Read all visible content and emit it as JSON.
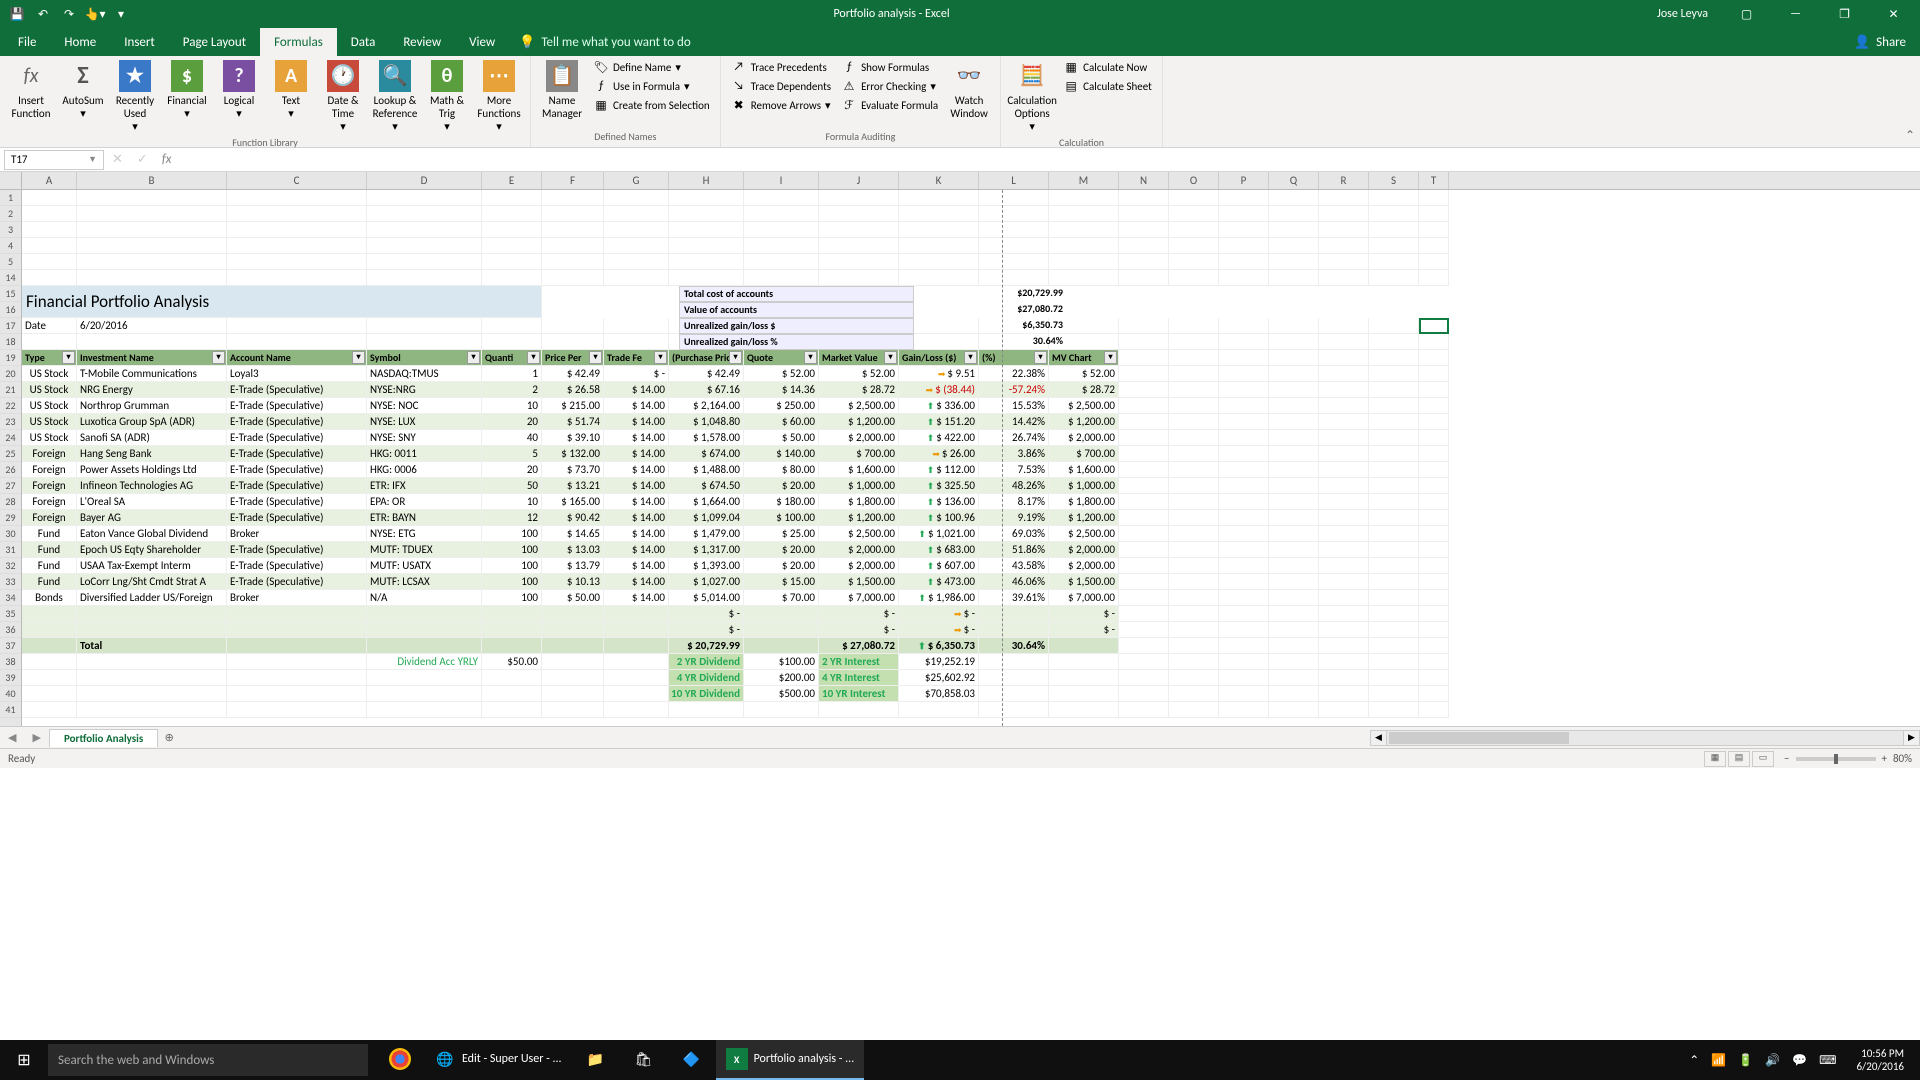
{
  "titlebar": {
    "title": "Portfolio analysis - Excel",
    "user": "Jose Leyva"
  },
  "tabs": [
    "File",
    "Home",
    "Insert",
    "Page Layout",
    "Formulas",
    "Data",
    "Review",
    "View"
  ],
  "active_tab": "Formulas",
  "tell_me": "Tell me what you want to do",
  "share": "Share",
  "ribbon": {
    "groups": {
      "fl": "Function Library",
      "dn": "Defined Names",
      "fa": "Formula Auditing",
      "ca": "Calculation"
    },
    "buttons": {
      "insert_fn": "Insert Function",
      "autosum": "AutoSum",
      "recent": "Recently Used",
      "financial": "Financial",
      "logical": "Logical",
      "text": "Text",
      "datetime": "Date & Time",
      "lookup": "Lookup & Reference",
      "math": "Math & Trig",
      "more": "More Functions",
      "name_mgr": "Name Manager",
      "def_name": "Define Name",
      "use_formula": "Use in Formula",
      "create_sel": "Create from Selection",
      "trace_prec": "Trace Precedents",
      "trace_dep": "Trace Dependents",
      "remove_arr": "Remove Arrows",
      "show_form": "Show Formulas",
      "err_check": "Error Checking",
      "eval_form": "Evaluate Formula",
      "watch": "Watch Window",
      "calc_opt": "Calculation Options",
      "calc_now": "Calculate Now",
      "calc_sheet": "Calculate Sheet"
    }
  },
  "namebox": "T17",
  "columns": [
    "A",
    "B",
    "C",
    "D",
    "E",
    "F",
    "G",
    "H",
    "I",
    "J",
    "K",
    "L",
    "M",
    "N",
    "O",
    "P",
    "Q",
    "R",
    "S",
    "T"
  ],
  "row_nums_top": [
    "1",
    "2",
    "3",
    "4",
    "5",
    "14"
  ],
  "portfolio": {
    "title": "Financial Portfolio Analysis",
    "date_label": "Date",
    "date": "6/20/2016",
    "summary": [
      {
        "label": "Total cost of accounts",
        "value": "$20,729.99"
      },
      {
        "label": "Value of accounts",
        "value": "$27,080.72"
      },
      {
        "label": "Unrealized gain/loss $",
        "value": "$6,350.73"
      },
      {
        "label": "Unrealized gain/loss %",
        "value": "30.64%"
      }
    ],
    "headers": [
      "Type",
      "Investment Name",
      "Account Name",
      "Symbol",
      "Quanti",
      "Price Per",
      "Trade Fe",
      "(Purchase Pric",
      "Quote",
      "Market Value",
      "Gain/Loss ($)",
      "(%)",
      "MV Chart"
    ],
    "rows": [
      {
        "n": "20",
        "type": "US Stock",
        "inv": "T-Mobile Communications",
        "acct": "Loyal3",
        "sym": "NASDAQ:TMUS",
        "qty": "1",
        "pp": "42.49",
        "tf": "-",
        "pur": "42.49",
        "q": "52.00",
        "mv": "52.00",
        "gl": "9.51",
        "pct": "22.38%",
        "mvc": "52.00",
        "arr": "dn"
      },
      {
        "n": "21",
        "type": "US Stock",
        "inv": "NRG Energy",
        "acct": "E-Trade (Speculative)",
        "sym": "NYSE:NRG",
        "qty": "2",
        "pp": "26.58",
        "tf": "14.00",
        "pur": "67.16",
        "q": "14.36",
        "mv": "28.72",
        "gl": "(38.44)",
        "pct": "-57.24%",
        "mvc": "28.72",
        "arr": "dn",
        "neg": true
      },
      {
        "n": "22",
        "type": "US Stock",
        "inv": "Northrop Grumman",
        "acct": "E-Trade (Speculative)",
        "sym": "NYSE: NOC",
        "qty": "10",
        "pp": "215.00",
        "tf": "14.00",
        "pur": "2,164.00",
        "q": "250.00",
        "mv": "2,500.00",
        "gl": "336.00",
        "pct": "15.53%",
        "mvc": "2,500.00",
        "arr": "up"
      },
      {
        "n": "23",
        "type": "US Stock",
        "inv": "Luxotica Group SpA (ADR)",
        "acct": "E-Trade (Speculative)",
        "sym": "NYSE: LUX",
        "qty": "20",
        "pp": "51.74",
        "tf": "14.00",
        "pur": "1,048.80",
        "q": "60.00",
        "mv": "1,200.00",
        "gl": "151.20",
        "pct": "14.42%",
        "mvc": "1,200.00",
        "arr": "up"
      },
      {
        "n": "24",
        "type": "US Stock",
        "inv": "Sanofi SA (ADR)",
        "acct": "E-Trade (Speculative)",
        "sym": "NYSE: SNY",
        "qty": "40",
        "pp": "39.10",
        "tf": "14.00",
        "pur": "1,578.00",
        "q": "50.00",
        "mv": "2,000.00",
        "gl": "422.00",
        "pct": "26.74%",
        "mvc": "2,000.00",
        "arr": "up"
      },
      {
        "n": "25",
        "type": "Foreign",
        "inv": "Hang Seng Bank",
        "acct": "E-Trade (Speculative)",
        "sym": "HKG: 0011",
        "qty": "5",
        "pp": "132.00",
        "tf": "14.00",
        "pur": "674.00",
        "q": "140.00",
        "mv": "700.00",
        "gl": "26.00",
        "pct": "3.86%",
        "mvc": "700.00",
        "arr": "dn"
      },
      {
        "n": "26",
        "type": "Foreign",
        "inv": "Power Assets Holdings Ltd",
        "acct": "E-Trade (Speculative)",
        "sym": "HKG: 0006",
        "qty": "20",
        "pp": "73.70",
        "tf": "14.00",
        "pur": "1,488.00",
        "q": "80.00",
        "mv": "1,600.00",
        "gl": "112.00",
        "pct": "7.53%",
        "mvc": "1,600.00",
        "arr": "up"
      },
      {
        "n": "27",
        "type": "Foreign",
        "inv": "Infineon Technologies AG",
        "acct": "E-Trade (Speculative)",
        "sym": "ETR: IFX",
        "qty": "50",
        "pp": "13.21",
        "tf": "14.00",
        "pur": "674.50",
        "q": "20.00",
        "mv": "1,000.00",
        "gl": "325.50",
        "pct": "48.26%",
        "mvc": "1,000.00",
        "arr": "up"
      },
      {
        "n": "28",
        "type": "Foreign",
        "inv": "L'Oreal SA",
        "acct": "E-Trade (Speculative)",
        "sym": "EPA: OR",
        "qty": "10",
        "pp": "165.00",
        "tf": "14.00",
        "pur": "1,664.00",
        "q": "180.00",
        "mv": "1,800.00",
        "gl": "136.00",
        "pct": "8.17%",
        "mvc": "1,800.00",
        "arr": "up"
      },
      {
        "n": "29",
        "type": "Foreign",
        "inv": "Bayer AG",
        "acct": "E-Trade (Speculative)",
        "sym": "ETR: BAYN",
        "qty": "12",
        "pp": "90.42",
        "tf": "14.00",
        "pur": "1,099.04",
        "q": "100.00",
        "mv": "1,200.00",
        "gl": "100.96",
        "pct": "9.19%",
        "mvc": "1,200.00",
        "arr": "up"
      },
      {
        "n": "30",
        "type": "Fund",
        "inv": "Eaton Vance Global Dividend",
        "acct": "Broker",
        "sym": "NYSE: ETG",
        "qty": "100",
        "pp": "14.65",
        "tf": "14.00",
        "pur": "1,479.00",
        "q": "25.00",
        "mv": "2,500.00",
        "gl": "1,021.00",
        "pct": "69.03%",
        "mvc": "2,500.00",
        "arr": "up"
      },
      {
        "n": "31",
        "type": "Fund",
        "inv": "Epoch US Eqty Shareholder",
        "acct": "E-Trade (Speculative)",
        "sym": "MUTF: TDUEX",
        "qty": "100",
        "pp": "13.03",
        "tf": "14.00",
        "pur": "1,317.00",
        "q": "20.00",
        "mv": "2,000.00",
        "gl": "683.00",
        "pct": "51.86%",
        "mvc": "2,000.00",
        "arr": "up"
      },
      {
        "n": "32",
        "type": "Fund",
        "inv": "USAA Tax-Exempt Interm",
        "acct": "E-Trade (Speculative)",
        "sym": "MUTF: USATX",
        "qty": "100",
        "pp": "13.79",
        "tf": "14.00",
        "pur": "1,393.00",
        "q": "20.00",
        "mv": "2,000.00",
        "gl": "607.00",
        "pct": "43.58%",
        "mvc": "2,000.00",
        "arr": "up"
      },
      {
        "n": "33",
        "type": "Fund",
        "inv": "LoCorr Lng/Sht Cmdt Strat A",
        "acct": "E-Trade (Speculative)",
        "sym": "MUTF: LCSAX",
        "qty": "100",
        "pp": "10.13",
        "tf": "14.00",
        "pur": "1,027.00",
        "q": "15.00",
        "mv": "1,500.00",
        "gl": "473.00",
        "pct": "46.06%",
        "mvc": "1,500.00",
        "arr": "up"
      },
      {
        "n": "34",
        "type": "Bonds",
        "inv": "Diversified Ladder US/Foreign",
        "acct": "Broker",
        "sym": "N/A",
        "qty": "100",
        "pp": "50.00",
        "tf": "14.00",
        "pur": "5,014.00",
        "q": "70.00",
        "mv": "7,000.00",
        "gl": "1,986.00",
        "pct": "39.61%",
        "mvc": "7,000.00",
        "arr": "up"
      }
    ],
    "total": {
      "label": "Total",
      "pur": "20,729.99",
      "mv": "27,080.72",
      "gl": "6,350.73",
      "pct": "30.64%"
    },
    "div_label": "Dividend Acc YRLY",
    "div_val": "$50.00",
    "proj": [
      {
        "d": "2 YR Dividend",
        "dv": "$100.00",
        "i": "2 YR Interest",
        "iv": "$19,252.19"
      },
      {
        "d": "4 YR Dividend",
        "dv": "$200.00",
        "i": "4 YR Interest",
        "iv": "$25,602.92"
      },
      {
        "d": "10 YR Dividend",
        "dv": "$500.00",
        "i": "10 YR Interest",
        "iv": "$70,858.03"
      }
    ]
  },
  "sheet_tab": "Portfolio Analysis",
  "status": {
    "ready": "Ready",
    "zoom": "80%"
  },
  "taskbar": {
    "search_ph": "Search the web and Windows",
    "chrome": "Edit - Super User - ...",
    "excel": "Portfolio analysis - ...",
    "time": "10:56 PM",
    "date": "6/20/2016"
  }
}
